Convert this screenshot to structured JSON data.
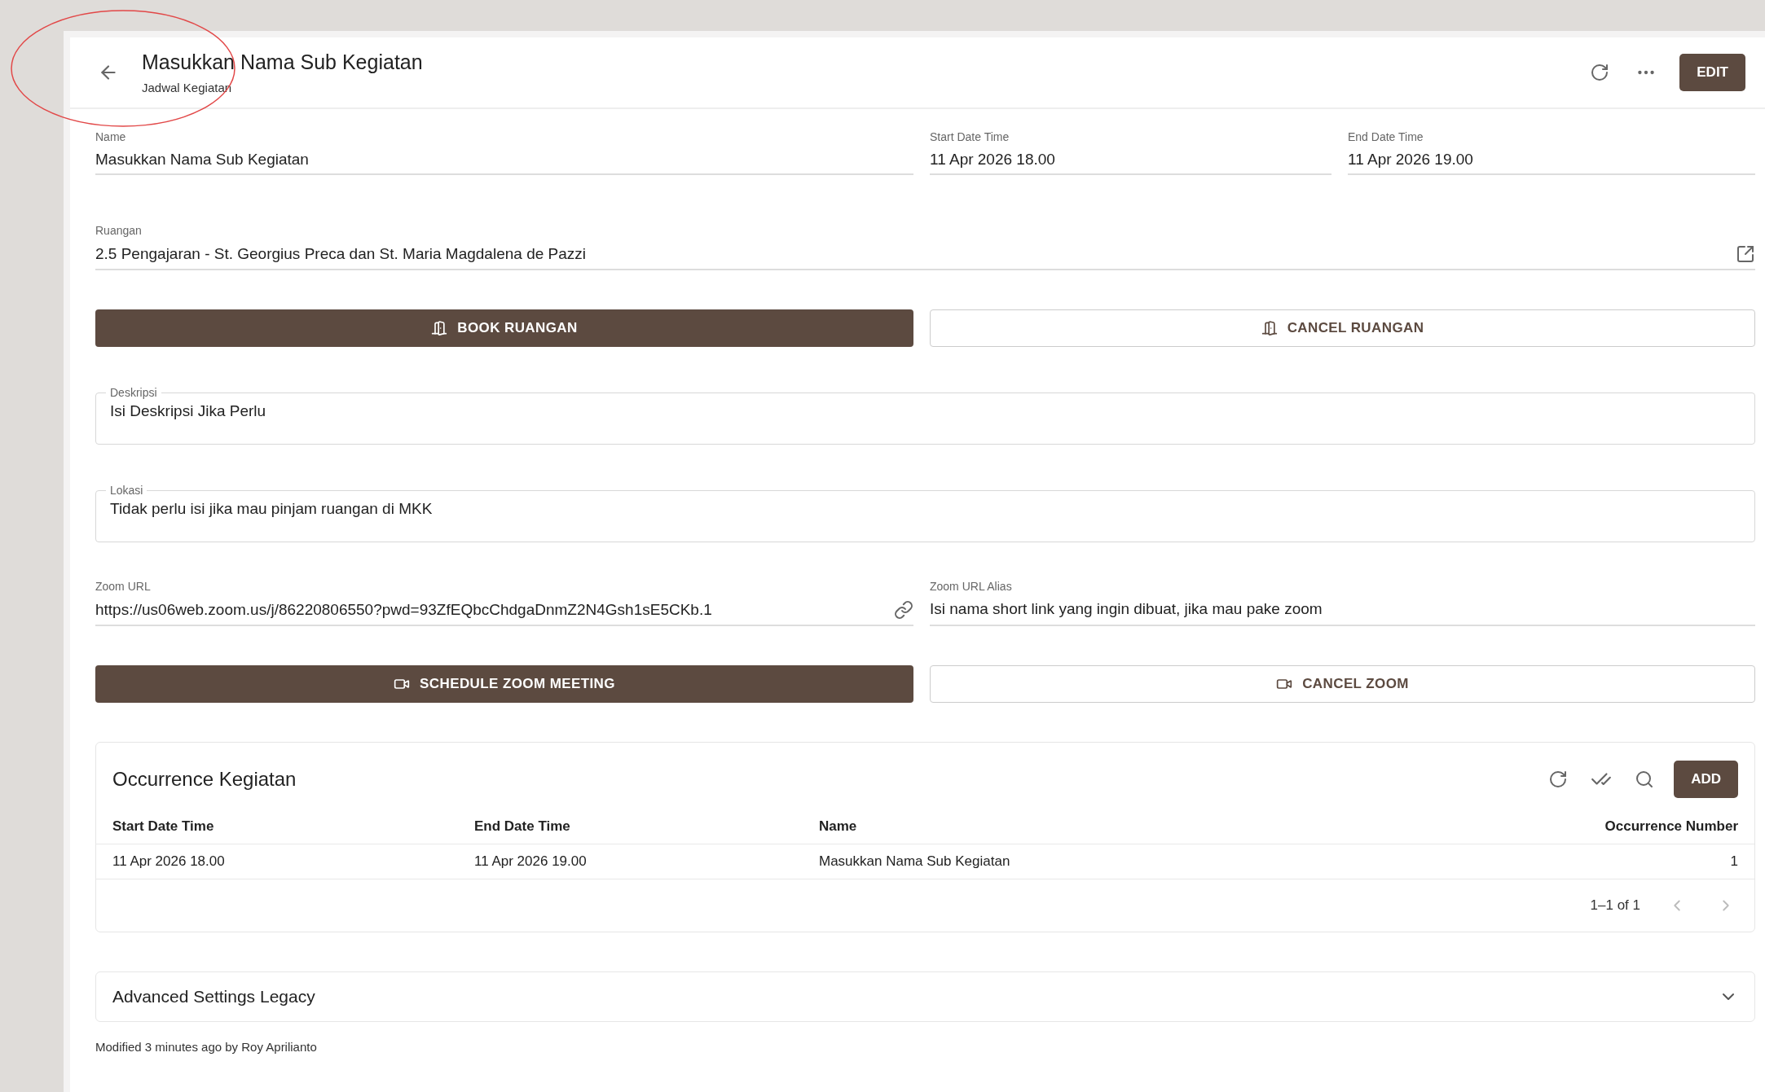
{
  "header": {
    "title": "Masukkan Nama Sub Kegiatan",
    "subtitle": "Jadwal Kegiatan",
    "edit_button": "EDIT"
  },
  "fields_row": [
    {
      "label": "Name",
      "value": "Masukkan Nama Sub Kegiatan"
    },
    {
      "label": "Start Date Time",
      "value": "11 Apr 2026 18.00"
    },
    {
      "label": "End Date Time",
      "value": "11 Apr 2026 19.00"
    }
  ],
  "ruangan": {
    "label": "Ruangan",
    "value": "2.5 Pengajaran - St. Georgius Preca dan St. Maria Magdalena de Pazzi"
  },
  "room_buttons": [
    {
      "label": "BOOK RUANGAN",
      "kind": "primary"
    },
    {
      "label": "CANCEL RUANGAN",
      "kind": "outline"
    }
  ],
  "deskripsi": {
    "label": "Deskripsi",
    "value": "Isi Deskripsi Jika Perlu"
  },
  "lokasi": {
    "label": "Lokasi",
    "value": "Tidak perlu isi jika mau pinjam ruangan di MKK"
  },
  "zoom_url": {
    "label": "Zoom URL",
    "value": "https://us06web.zoom.us/j/86220806550?pwd=93ZfEQbcChdgaDnmZ2N4Gsh1sE5CKb.1"
  },
  "zoom_alias": {
    "label": "Zoom URL Alias",
    "value": "Isi nama short link yang ingin dibuat, jika mau pake zoom"
  },
  "zoom_buttons": [
    {
      "label": "SCHEDULE ZOOM MEETING",
      "kind": "primary"
    },
    {
      "label": "CANCEL ZOOM",
      "kind": "outline"
    }
  ],
  "occurrences": {
    "title": "Occurrence Kegiatan",
    "add_button": "ADD",
    "columns": [
      "Start Date Time",
      "End Date Time",
      "Name",
      "Occurrence Number"
    ],
    "rows": [
      [
        "11 Apr 2026 18.00",
        "11 Apr 2026 19.00",
        "Masukkan Nama Sub Kegiatan",
        "1"
      ]
    ],
    "pagination": "1–1 of 1"
  },
  "advanced": {
    "title": "Advanced Settings Legacy",
    "expanded": false
  },
  "footer": "Modified 3 minutes ago by Roy Aprilianto"
}
